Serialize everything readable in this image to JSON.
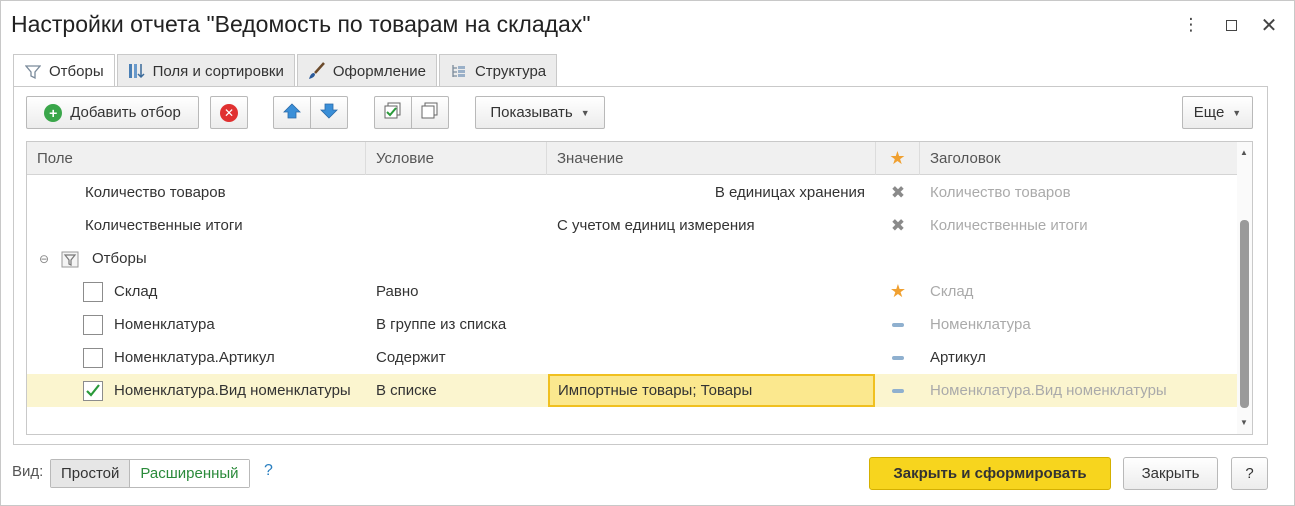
{
  "window": {
    "title": "Настройки отчета \"Ведомость по товарам на складах\"",
    "controls": [
      "more-icon",
      "maximize-icon",
      "close-icon"
    ]
  },
  "tabs": [
    {
      "label": "Отборы",
      "icon": "filter-icon",
      "active": true
    },
    {
      "label": "Поля и сортировки",
      "icon": "sort-icon",
      "active": false
    },
    {
      "label": "Оформление",
      "icon": "brush-icon",
      "active": false
    },
    {
      "label": "Структура",
      "icon": "structure-icon",
      "active": false
    }
  ],
  "toolbar": {
    "add_filter": "Добавить отбор",
    "show": "Показывать",
    "more": "Еще"
  },
  "table": {
    "headers": {
      "field": "Поле",
      "condition": "Условие",
      "value": "Значение",
      "title": "Заголовок"
    },
    "rows": [
      {
        "field": "Количество товаров",
        "condition": "",
        "value": "В единицах хранения",
        "title": "Количество товаров"
      },
      {
        "field": "Количественные итоги",
        "condition": "",
        "value": "С учетом единиц измерения",
        "title": "Количественные итоги"
      },
      {
        "field": "Отборы"
      },
      {
        "field": "Склад",
        "condition": "Равно",
        "value": "",
        "title": "Склад"
      },
      {
        "field": "Номенклатура",
        "condition": "В группе из списка",
        "value": "",
        "title": "Номенклатура"
      },
      {
        "field": "Номенклатура.Артикул",
        "condition": "Содержит",
        "value": "",
        "title": "Артикул"
      },
      {
        "field": "Номенклатура.Вид номенклатуры",
        "condition": "В списке",
        "value": "Импортные товары; Товары",
        "title": "Номенклатура.Вид номенклатуры"
      }
    ]
  },
  "footer": {
    "view_label": "Вид:",
    "view_simple": "Простой",
    "view_extended": "Расширенный",
    "help": "?",
    "close_generate": "Закрыть и сформировать",
    "close": "Закрыть",
    "question": "?"
  },
  "colors": {
    "accent_yellow": "#f7d51e",
    "selected_row": "#fbf5cf",
    "link_green": "#2a8a3a"
  }
}
